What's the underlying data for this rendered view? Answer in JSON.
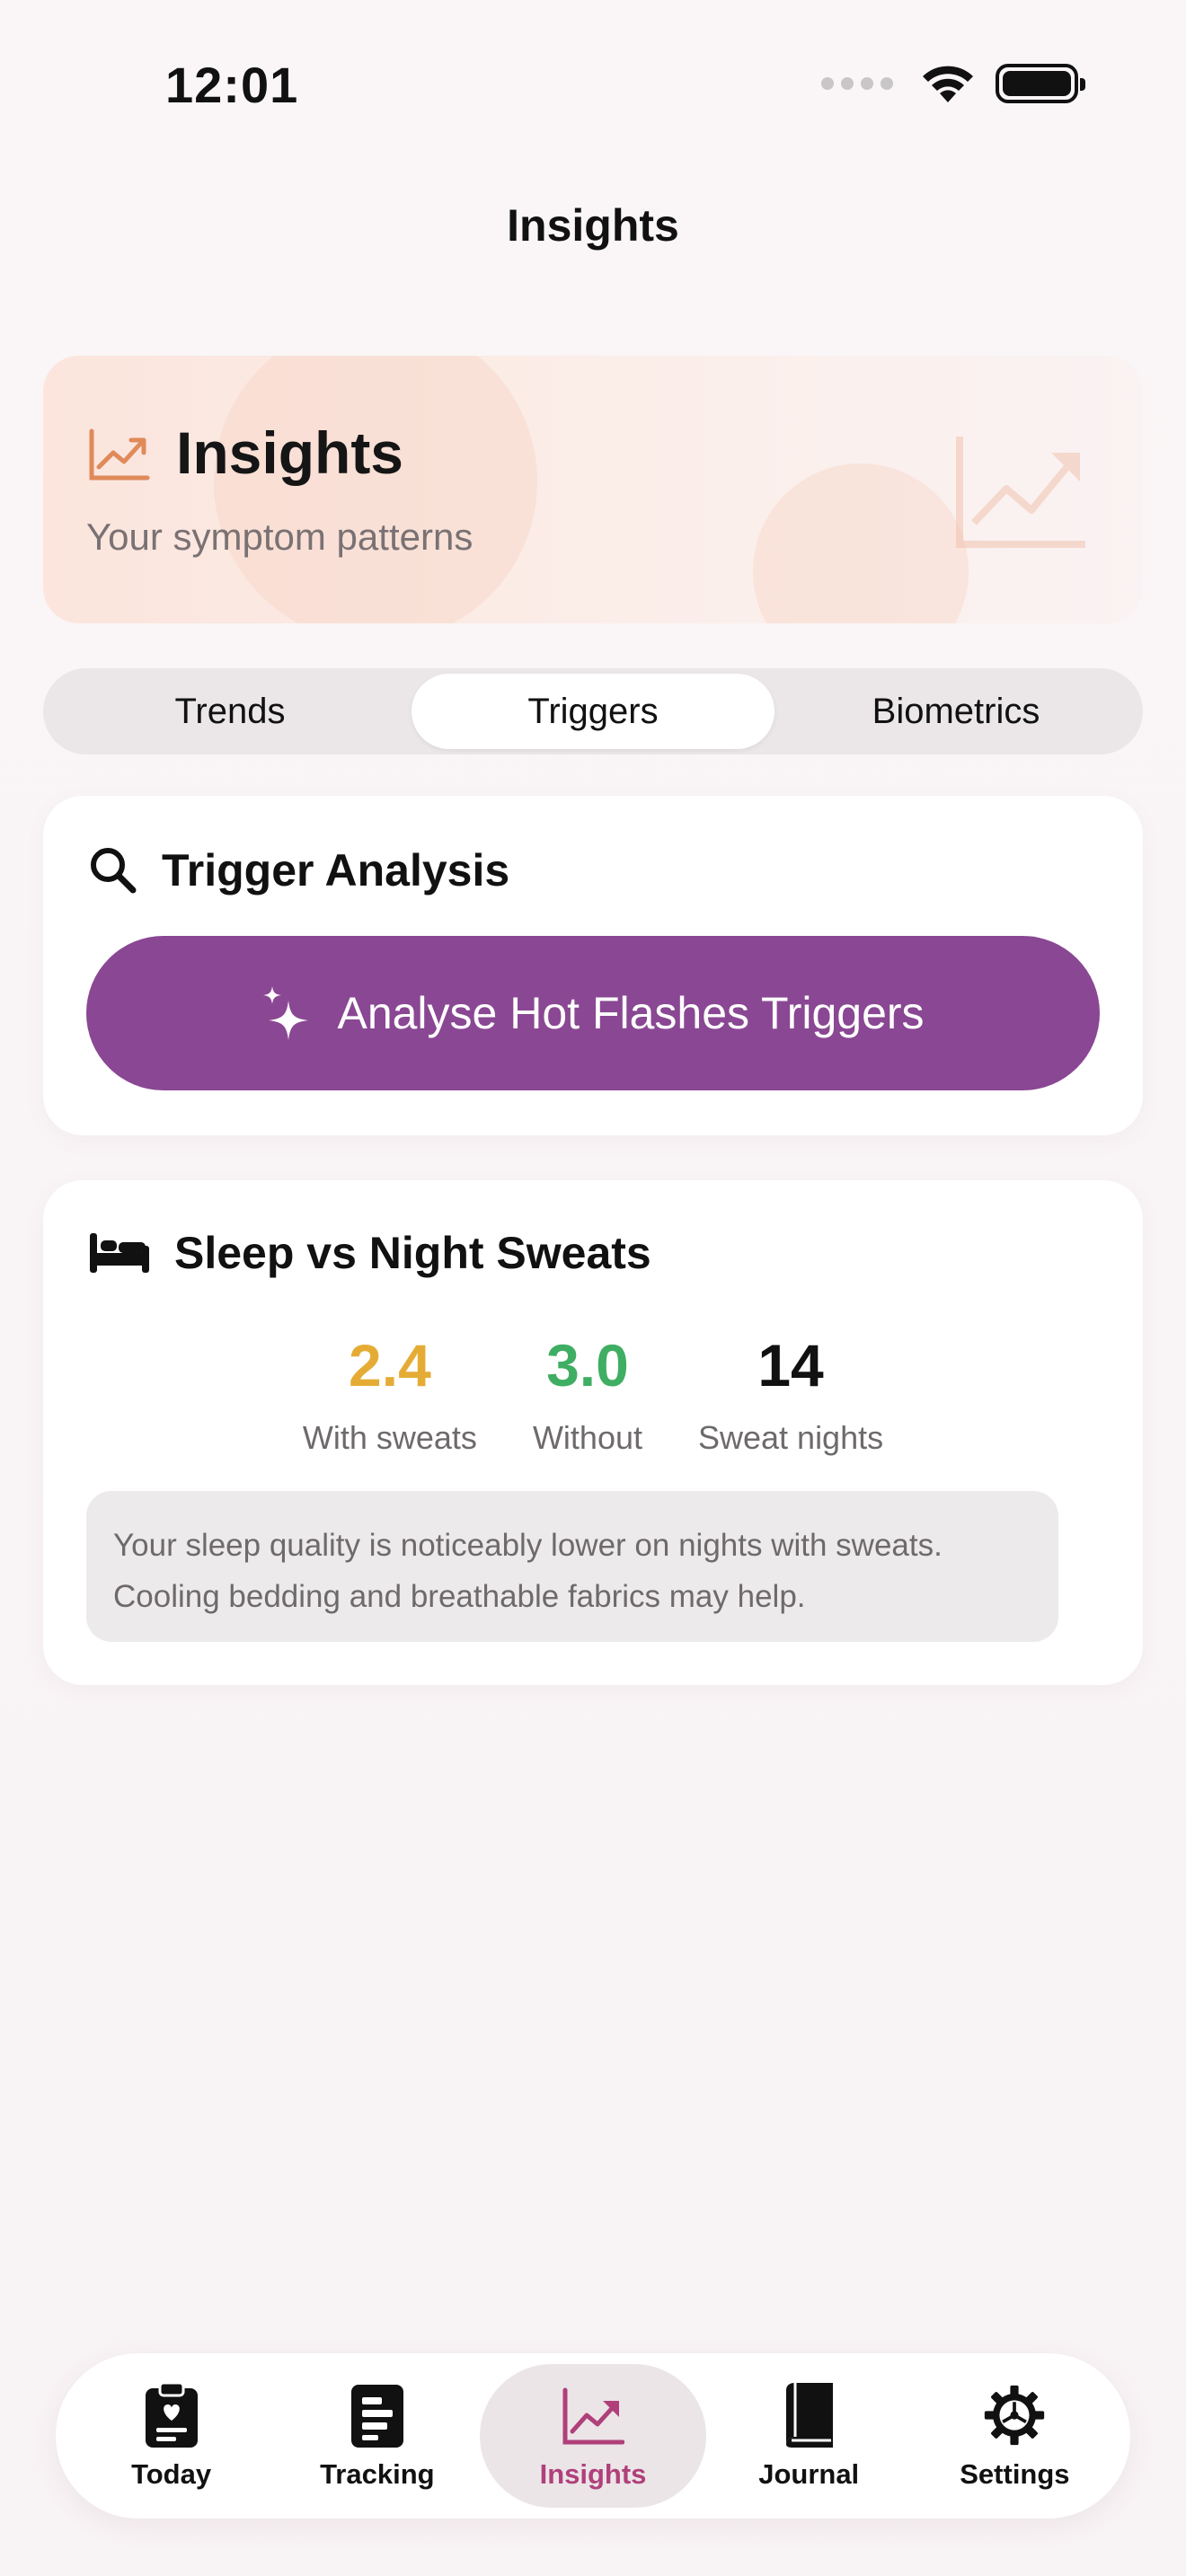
{
  "status_bar": {
    "time": "12:01"
  },
  "nav": {
    "title": "Insights"
  },
  "header": {
    "title": "Insights",
    "subtitle": "Your symptom patterns",
    "icon": "chart-line-up-icon"
  },
  "segments": [
    {
      "label": "Trends",
      "active": false
    },
    {
      "label": "Triggers",
      "active": true
    },
    {
      "label": "Biometrics",
      "active": false
    }
  ],
  "trigger_analysis": {
    "title": "Trigger Analysis",
    "icon": "magnifier-icon",
    "button_label": "Analyse Hot Flashes Triggers",
    "button_icon": "sparkles-icon"
  },
  "sleep": {
    "title": "Sleep vs Night Sweats",
    "icon": "bed-icon",
    "stats": [
      {
        "value": "2.4",
        "label": "With sweats",
        "color": "#e5ac35"
      },
      {
        "value": "3.0",
        "label": "Without",
        "color": "#3fae63"
      },
      {
        "value": "14",
        "label": "Sweat nights",
        "color": "#111111"
      }
    ],
    "note": "Your sleep quality is noticeably lower on nights with sweats. Cooling bedding and breathable fabrics may help."
  },
  "tabbar": {
    "items": [
      {
        "label": "Today",
        "icon": "clipboard-heart-icon",
        "active": false
      },
      {
        "label": "Tracking",
        "icon": "document-list-icon",
        "active": false
      },
      {
        "label": "Insights",
        "icon": "chart-line-up-icon",
        "active": true
      },
      {
        "label": "Journal",
        "icon": "book-icon",
        "active": false
      },
      {
        "label": "Settings",
        "icon": "gear-icon",
        "active": false
      }
    ]
  },
  "colors": {
    "accent": "#8a4793",
    "tab_active": "#b0407a",
    "header_icon": "#e08a5a"
  }
}
